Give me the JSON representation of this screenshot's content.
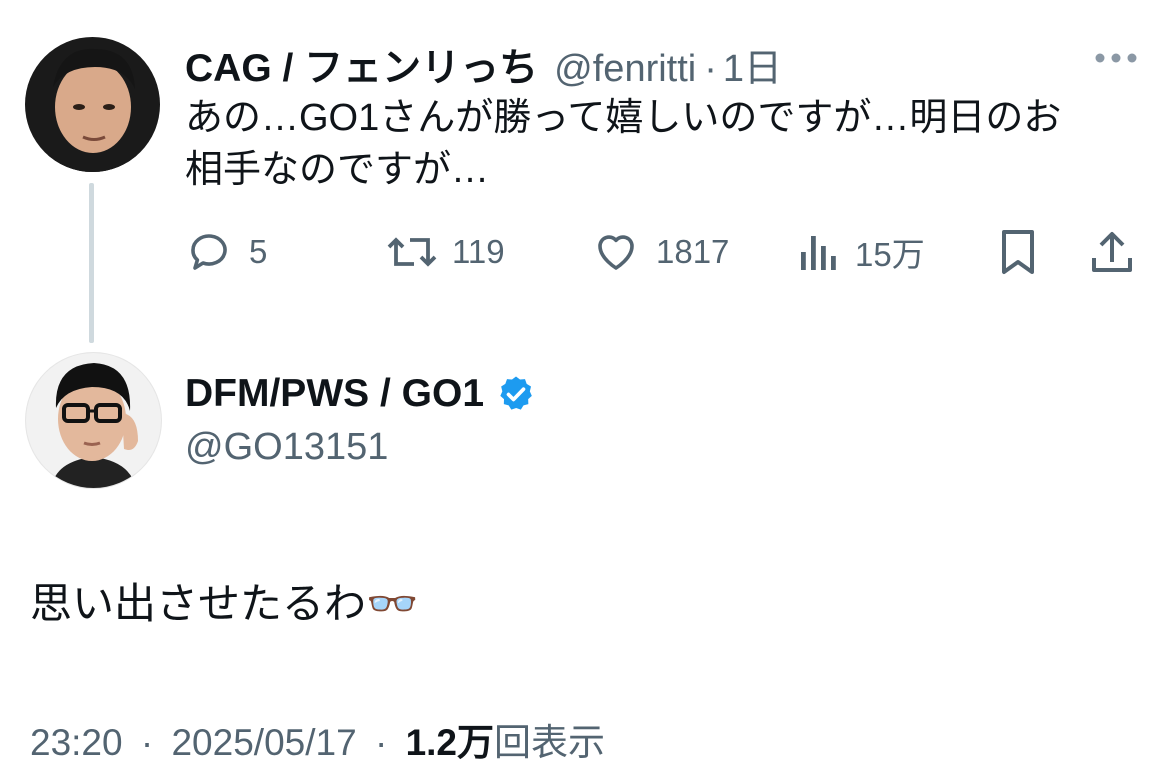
{
  "tweet1": {
    "name": "CAG / フェンリっち",
    "handle": "@fenritti",
    "dot": "·",
    "time": "1日",
    "text_line1": "あの…GO1さんが勝って嬉しいのですが…明日のお",
    "text_line2": "相手なのですが…",
    "more_icon": "more-horizontal-icon",
    "actions": {
      "reply_count": "5",
      "retweet_count": "119",
      "like_count": "1817",
      "views_count": "15万"
    }
  },
  "tweet2": {
    "name": "DFM/PWS / GO1",
    "handle": "@GO13151",
    "verified": true,
    "text": "思い出させたるわ👓",
    "time": "23:20",
    "sep1": "·",
    "date": "2025/05/17",
    "sep2": "·",
    "views_value": "1.2万",
    "views_label": "回表示"
  },
  "colors": {
    "text": "#0f1419",
    "secondary": "#536471",
    "verified": "#1d9bf0",
    "thread_line": "#cfd9de"
  }
}
